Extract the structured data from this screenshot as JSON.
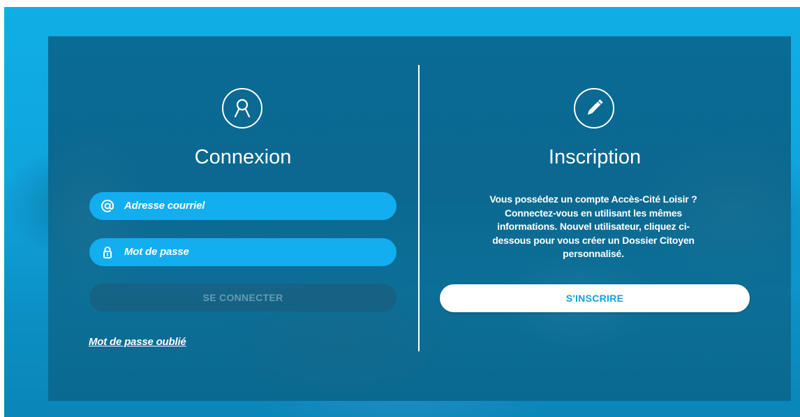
{
  "login": {
    "title": "Connexion",
    "email_placeholder": "Adresse courriel",
    "password_placeholder": "Mot de passe",
    "submit_label": "SE CONNECTER",
    "forgot_label": "Mot de passe oublié",
    "icon": "user-icon"
  },
  "signup": {
    "title": "Inscription",
    "description": "Vous possédez un compte Accès-Cité Loisir ? Connectez-vous en utilisant les mêmes informations. Nouvel utilisateur, cliquez ci-dessous pour vous créer un Dossier Citoyen personnalisé.",
    "submit_label": "S'INSCRIRE",
    "icon": "pencil-icon"
  },
  "colors": {
    "accent": "#12aef0",
    "panel": "#0b6990",
    "signup_text": "#0fa2de"
  }
}
